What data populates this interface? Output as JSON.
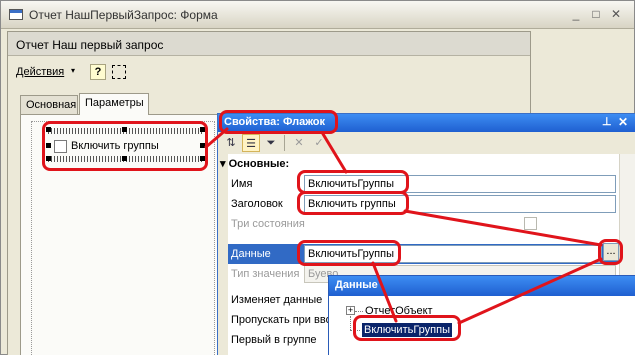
{
  "outer_window": {
    "title": "Отчет НашПервыйЗапрос: Форма",
    "buttons": {
      "minimize": "_",
      "maximize": "□",
      "close": "✕"
    }
  },
  "form": {
    "title": "Отчет  Наш первый запрос",
    "toolbar": {
      "actions_label": "Действия",
      "actions_caret": "▾",
      "help_label": "?"
    },
    "tabs": [
      {
        "label": "Основная",
        "active": false
      },
      {
        "label": "Параметры",
        "active": true
      }
    ],
    "checkbox_label": "Включить группы"
  },
  "properties": {
    "title": "Свойства: Флажок",
    "pin_glyph": "⊥",
    "close_glyph": "✕",
    "toolbar_icons": [
      {
        "name": "sort-alpha-icon",
        "glyph": "⇅"
      },
      {
        "name": "categorized-icon",
        "glyph": "☰"
      },
      {
        "name": "filter-icon",
        "glyph": "⏷"
      },
      {
        "name": "delete-icon",
        "glyph": "✕"
      },
      {
        "name": "check-icon",
        "glyph": "✓"
      }
    ],
    "section": {
      "expander": "▾",
      "label": "Основные:"
    },
    "rows": {
      "name": {
        "key": "Имя",
        "value": "ВключитьГруппы"
      },
      "header": {
        "key": "Заголовок",
        "value": "Включить группы"
      },
      "three_state": {
        "key": "Три состояния"
      },
      "data": {
        "key": "Данные",
        "value": "ВключитьГруппы",
        "button": "..."
      },
      "value_type": {
        "key": "Тип значения",
        "value": "Буево"
      },
      "changes_data": {
        "key": "Изменяет данные"
      },
      "skip_on_input": {
        "key": "Пропускать при вво"
      },
      "first_in_group": {
        "key": "Первый в группе"
      }
    }
  },
  "data_popup": {
    "title": "Данные",
    "tree": [
      {
        "label": "ОтчетОбъект",
        "expander": "+"
      },
      {
        "label": "ВключитьГруппы",
        "selected": true
      }
    ]
  },
  "annotation_color": "#e0141b"
}
